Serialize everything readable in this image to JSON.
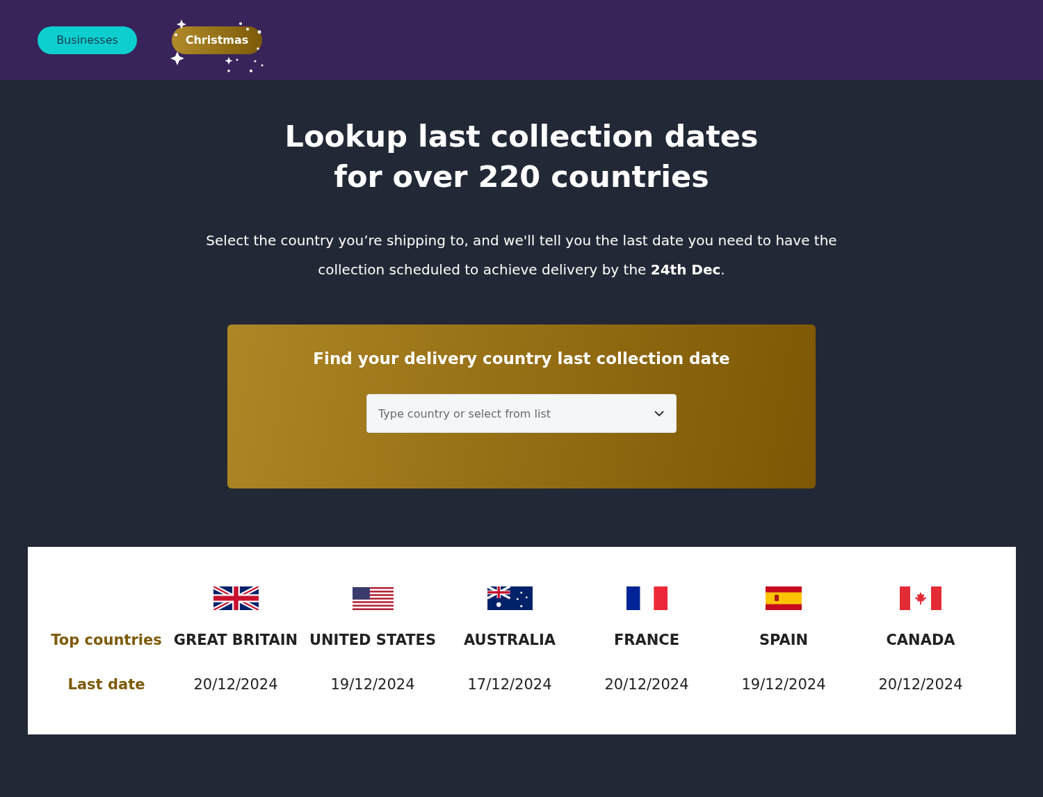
{
  "tabs": [
    {
      "label": "Businesses",
      "selected": false
    },
    {
      "label": "Christmas",
      "selected": true
    }
  ],
  "heading": [
    "Lookup last collection dates",
    "for over 220 countries"
  ],
  "intro": "Select the country you’re shipping to, and we'll tell you the last date you need to have the collection scheduled to achieve delivery by the **24th Dec**.",
  "finder": {
    "title": "Find your delivery country last collection date",
    "placeholder": "Type country or select from list"
  },
  "table": {
    "row_labels": [
      "Top countries",
      "Last date"
    ],
    "countries": [
      {
        "kind": "gb",
        "name": "GREAT BRITAIN",
        "date": "20/12/2024"
      },
      {
        "kind": "us",
        "name": "UNITED STATES",
        "date": "19/12/2024"
      },
      {
        "kind": "au",
        "name": "AUSTRALIA",
        "date": "17/12/2024"
      },
      {
        "kind": "fr",
        "name": "FRANCE",
        "date": "20/12/2024"
      },
      {
        "kind": "es",
        "name": "SPAIN",
        "date": "19/12/2024"
      },
      {
        "kind": "ca",
        "name": "CANADA",
        "date": "20/12/2024"
      }
    ]
  }
}
